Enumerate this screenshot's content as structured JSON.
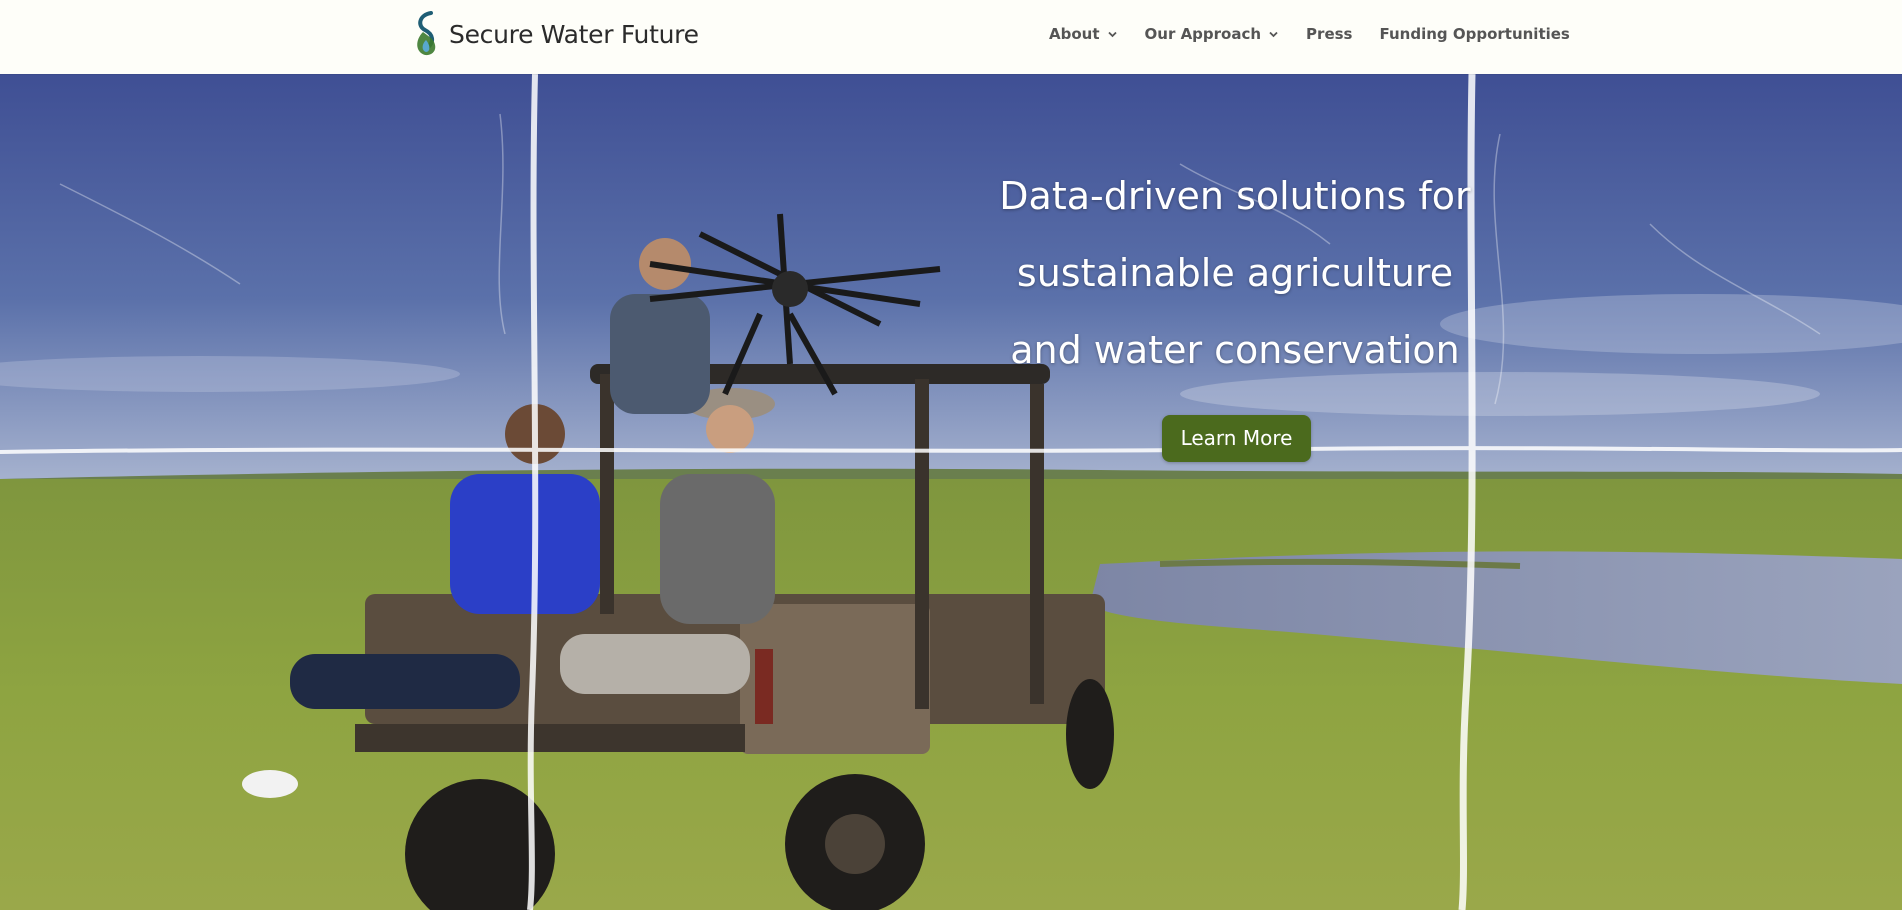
{
  "header": {
    "logo_text": "Secure Water Future",
    "nav": [
      {
        "label": "About",
        "has_dropdown": true
      },
      {
        "label": "Our Approach",
        "has_dropdown": true
      },
      {
        "label": "Press",
        "has_dropdown": false
      },
      {
        "label": "Funding Opportunities",
        "has_dropdown": false
      }
    ]
  },
  "hero": {
    "headline": "Data-driven solutions for sustainable agriculture and water conservation",
    "cta_label": "Learn More",
    "image_description_icon": "team-with-drone-on-utility-vehicle"
  },
  "colors": {
    "header_bg": "#fefef9",
    "nav_text": "#555555",
    "cta_bg": "#4b6a1d",
    "sky": "#4a5fa0",
    "grass": "#8fa03e",
    "water": "#8a93ac"
  }
}
